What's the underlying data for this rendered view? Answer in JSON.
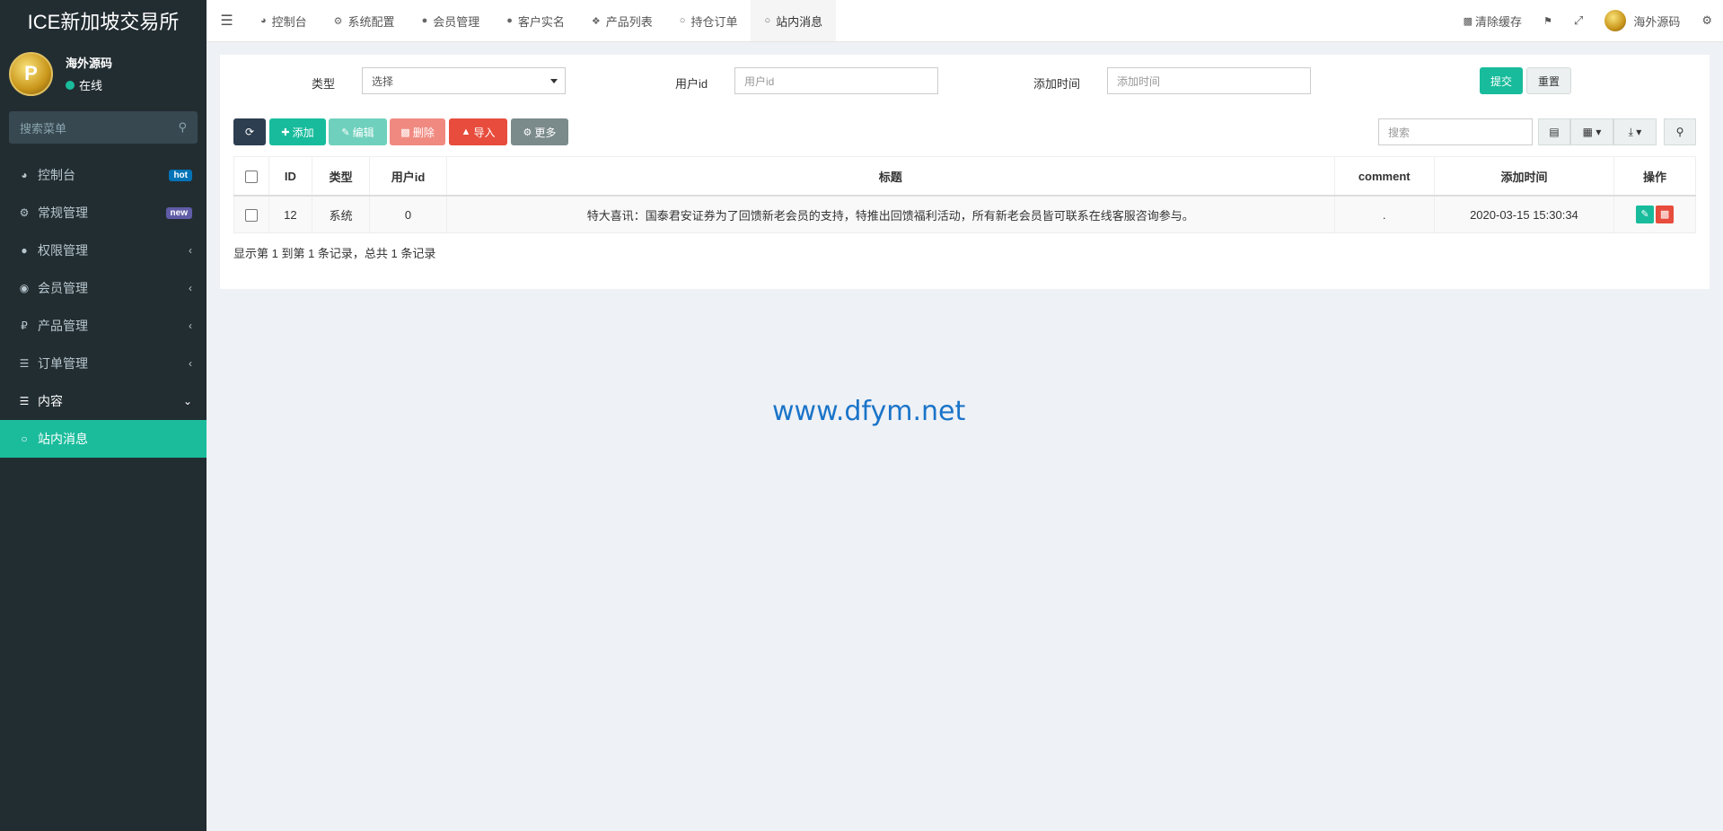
{
  "app": {
    "title": "ICE新加坡交易所"
  },
  "user": {
    "name": "海外源码",
    "status": "在线",
    "avatar_letter": "P"
  },
  "sidebar": {
    "search_placeholder": "搜索菜单",
    "items": [
      {
        "label": "控制台",
        "icon": "dashboard-icon",
        "glyph": "◕",
        "badge": "hot",
        "badge_color": "#0073b7"
      },
      {
        "label": "常规管理",
        "icon": "cogs-icon",
        "glyph": "⚙",
        "badge": "new",
        "badge_color": "#605ca8"
      },
      {
        "label": "权限管理",
        "icon": "group-icon",
        "glyph": "👥",
        "arrow": "‹"
      },
      {
        "label": "会员管理",
        "icon": "user-circle-icon",
        "glyph": "◉",
        "arrow": "‹"
      },
      {
        "label": "产品管理",
        "icon": "product-icon",
        "glyph": "₽",
        "arrow": "‹"
      },
      {
        "label": "订单管理",
        "icon": "list-icon",
        "glyph": "☰",
        "arrow": "‹"
      },
      {
        "label": "内容",
        "icon": "list-icon",
        "glyph": "☰",
        "arrow": "⌄"
      },
      {
        "label": "站内消息",
        "icon": "circle-icon",
        "glyph": "○"
      }
    ]
  },
  "topbar": {
    "tabs": [
      {
        "label": "控制台",
        "icon": "dashboard-icon",
        "glyph": "◕"
      },
      {
        "label": "系统配置",
        "icon": "gear-icon",
        "glyph": "⚙"
      },
      {
        "label": "会员管理",
        "icon": "user-icon",
        "glyph": "👤"
      },
      {
        "label": "客户实名",
        "icon": "user-icon",
        "glyph": "👤"
      },
      {
        "label": "产品列表",
        "icon": "cubes-icon",
        "glyph": "❖"
      },
      {
        "label": "持仓订单",
        "icon": "circle-icon",
        "glyph": "○"
      },
      {
        "label": "站内消息",
        "icon": "circle-icon",
        "glyph": "○"
      }
    ],
    "clear_cache": "清除缓存",
    "username": "海外源码"
  },
  "filter": {
    "type_label": "类型",
    "type_value": "选择",
    "userid_label": "用户id",
    "userid_placeholder": "用户id",
    "time_label": "添加时间",
    "time_placeholder": "添加时间",
    "submit": "提交",
    "reset": "重置"
  },
  "toolbar": {
    "add": "添加",
    "edit": "编辑",
    "delete": "删除",
    "import": "导入",
    "more": "更多",
    "search_placeholder": "搜索"
  },
  "table": {
    "headers": [
      "ID",
      "类型",
      "用户id",
      "标题",
      "comment",
      "添加时间",
      "操作"
    ],
    "rows": [
      {
        "id": "12",
        "type": "系统",
        "userid": "0",
        "title": "特大喜讯：国泰君安证券为了回馈新老会员的支持，特推出回馈福利活动，所有新老会员皆可联系在线客服咨询参与。",
        "comment": ".",
        "time": "2020-03-15 15:30:34"
      }
    ]
  },
  "pagination": "显示第 1 到第 1 条记录，总共 1 条记录",
  "watermark": "www.dfym.net",
  "colors": {
    "sidebar_bg": "#222d32",
    "accent": "#18bc9c",
    "refresh": "#2c3e50",
    "edit": "#6fd1bd",
    "delete": "#f08a80",
    "import": "#e74c3c",
    "more": "#7b8a8b"
  }
}
